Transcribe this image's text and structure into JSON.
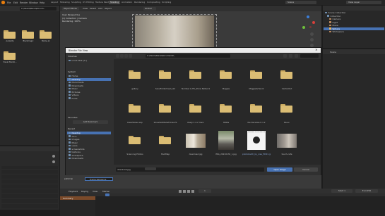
{
  "app": {
    "menu": [
      "File",
      "Edit",
      "Render",
      "Window",
      "Help"
    ],
    "workspaces": [
      "Layout",
      "Modeling",
      "Sculpting",
      "UV Editing",
      "Texture Paint",
      "Shading",
      "Animation",
      "Rendering",
      "Compositing",
      "Scripting"
    ],
    "active_workspace": "Shading",
    "scene": "Scene",
    "view_layer": "View Layer"
  },
  "left_browser": {
    "path": "C:\\Users\\Steve\\Docum...",
    "folders": [
      "Audacity",
      "Blackmagic",
      "Mame.ini",
      "Visual Studio..."
    ]
  },
  "viewport": {
    "mode": "Object Mode",
    "menu": [
      "View",
      "Select",
      "Add",
      "Object"
    ],
    "info_lines": [
      "User Perspective",
      "(1) Collection | Camera",
      "Rendering: 100%"
    ],
    "shading": "Global"
  },
  "outliner": {
    "title": "Scene Collection",
    "items": [
      "Collection",
      "Camera",
      "Light",
      "Plane",
      "Sphere",
      "Workspace"
    ]
  },
  "properties": {
    "title": "Scene"
  },
  "file_dialog": {
    "title": "Blender File View",
    "path": "C:\\Users\\Steve\\Documents\\",
    "volumes_header": "Volumes",
    "volumes": [
      "Local Disk (C:)"
    ],
    "system_header": "System",
    "system": [
      "Home",
      "Desktop",
      "Documents",
      "Downloads",
      "Music",
      "Pictures",
      "Videos",
      "Fonts"
    ],
    "favorites_header": "Favorites",
    "favorites_add": "Add Bookmark",
    "recent_header": "Recent",
    "recent": [
      "Desktop",
      "docs",
      "Images",
      "Music",
      "users",
      "screenshots",
      "textures",
      "workspace",
      "Downloads"
    ],
    "folders": [
      {
        "name": "gallery"
      },
      {
        "name": "SaveFolderUsed_old"
      },
      {
        "name": "Number & Fill_Show Network"
      },
      {
        "name": "Magpie"
      },
      {
        "name": "MaggieArtwork"
      },
      {
        "name": "CenterOut"
      },
      {
        "name": "DeskStates wip"
      },
      {
        "name": "ShowSlotMadeFolderVS"
      },
      {
        "name": "Pasty 1.4.2 main"
      },
      {
        "name": "HDRIs"
      },
      {
        "name": "Pie Decades 0.1.2"
      },
      {
        "name": "Music"
      },
      {
        "name": "Scanning Photos"
      },
      {
        "name": "ShotMap"
      }
    ],
    "images": [
      {
        "name": "download.jpg"
      },
      {
        "name": "IMG_20210132_1.jpg"
      },
      {
        "name": "photobooth_by_Lisa_HD01.jpg"
      },
      {
        "name": "touch-cafe"
      }
    ],
    "image_caption": "Welcome to the dark side",
    "filename_value": "download.jpg",
    "accept_label": "Open Image",
    "cancel_label": "Cancel"
  },
  "bottom_left": {
    "path_label": "path/clip",
    "image_label": "Frame Sequence"
  },
  "timeline": {
    "menu": [
      "Playback",
      "Keying",
      "View",
      "Marker"
    ],
    "frame": "1",
    "start": "Start 1",
    "end": "End 250",
    "track": "Summary"
  },
  "colors": {
    "accent": "#4772b3",
    "folder": "#dbbd74",
    "panel": "#282828",
    "dialog": "#2b2b2b"
  }
}
